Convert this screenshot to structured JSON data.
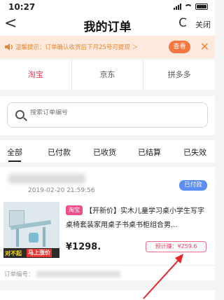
{
  "status_bar": {
    "time": "10:27"
  },
  "nav": {
    "back": "<",
    "title": "我的订单",
    "refresh": "C",
    "close": "关闭"
  },
  "notice": {
    "text": "温馨提示：订单确认收货后下月25号可提现 ＞",
    "button": "查看",
    "close": "✕"
  },
  "platform_tabs": [
    {
      "label": "淘宝",
      "active": true
    },
    {
      "label": "京东",
      "active": false
    },
    {
      "label": "拼多多",
      "active": false
    }
  ],
  "search": {
    "placeholder": "搜索订单编号"
  },
  "status_tabs": [
    {
      "label": "全部",
      "active": true
    },
    {
      "label": "已付款",
      "active": false
    },
    {
      "label": "已收货",
      "active": false
    },
    {
      "label": "已结算",
      "active": false
    },
    {
      "label": "已失效",
      "active": false
    }
  ],
  "order": {
    "date": "2019-02-20 21:59:56",
    "status": "已付款",
    "platform_tag": "淘宝",
    "product_name": "【开新价】实木儿童学习桌小学生写字桌椅套装家用桌子书桌书柜组合男...",
    "price": "¥1298.",
    "earn_label": "预计赚：¥259.6",
    "order_no_label": "订单编号：",
    "image_promo_1": "对不起",
    "image_promo_2": "马上涨价"
  },
  "colors": {
    "accent": "#ee3a5a",
    "notice_bg": "#fde9dd",
    "notice_text": "#e8882e",
    "view_button": "#f47740",
    "status_badge": "#5b8ef0",
    "arrow": "#e8252b"
  }
}
